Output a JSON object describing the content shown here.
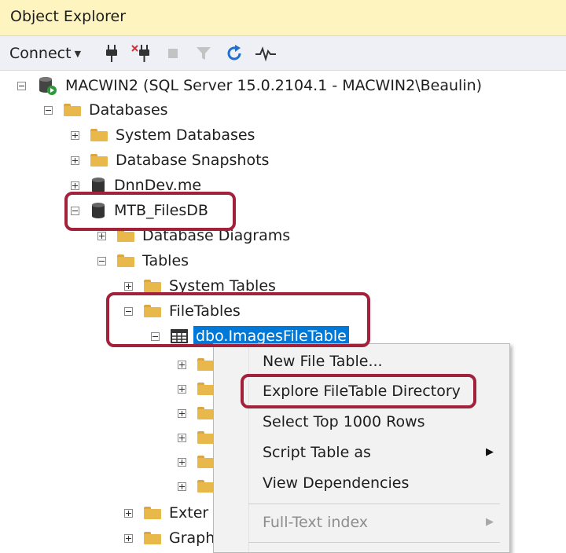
{
  "panel": {
    "title": "Object Explorer"
  },
  "toolbar": {
    "connect_label": "Connect",
    "icons": [
      "connect-plug-icon",
      "disconnect-icon",
      "stop-icon",
      "filter-icon",
      "refresh-icon",
      "activity-monitor-icon"
    ]
  },
  "tree": {
    "server": "MACWIN2 (SQL Server 15.0.2104.1 - MACWIN2\\Beaulin)",
    "databases": "Databases",
    "system_databases": "System Databases",
    "database_snapshots": "Database Snapshots",
    "dnndev": "DnnDev.me",
    "mtb_filesdb": "MTB_FilesDB",
    "database_diagrams": "Database Diagrams",
    "tables": "Tables",
    "system_tables": "System Tables",
    "filetables": "FileTables",
    "images_filetable": "dbo.ImagesFileTable",
    "external_partial": "Exter",
    "graph_partial": "Graph"
  },
  "context_menu": {
    "items": [
      "New File Table...",
      "Explore FileTable Directory",
      "Select Top 1000 Rows",
      "Script Table as",
      "View Dependencies",
      "Full-Text index"
    ]
  },
  "colors": {
    "title_bg": "#fdf4bf",
    "highlight_border": "#a2213b",
    "selection": "#0078d7"
  }
}
